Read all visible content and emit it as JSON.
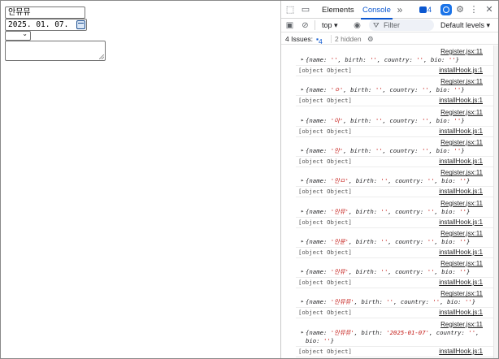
{
  "form": {
    "name_value": "안뮤뮤",
    "birth_value": "2025. 01. 07.",
    "country_value": "",
    "bio_value": ""
  },
  "devtools": {
    "tabs": [
      "Elements",
      "Console"
    ],
    "active_tab": "Console",
    "issue_badge_count": "4",
    "context": "top ▾",
    "filter_placeholder": "Filter",
    "levels": "Default levels ▾",
    "issues_label": "4 Issues:",
    "issues_count": "4",
    "hidden_label": "2 hidden"
  },
  "console": {
    "log_source": "Register.jsx:11",
    "hook_source": "installHook.js:1",
    "object_text": "[object Object]",
    "entries": [
      {
        "name": "",
        "birth": ""
      },
      {
        "name": "ㅇ",
        "birth": ""
      },
      {
        "name": "아",
        "birth": ""
      },
      {
        "name": "안",
        "birth": ""
      },
      {
        "name": "안ㅁ",
        "birth": ""
      },
      {
        "name": "안뮤",
        "birth": ""
      },
      {
        "name": "안뮨",
        "birth": ""
      },
      {
        "name": "안뮤",
        "birth": ""
      },
      {
        "name": "안뮤뮤",
        "birth": ""
      },
      {
        "name": "안뮤뮤",
        "birth": "2025-01-07"
      }
    ]
  }
}
